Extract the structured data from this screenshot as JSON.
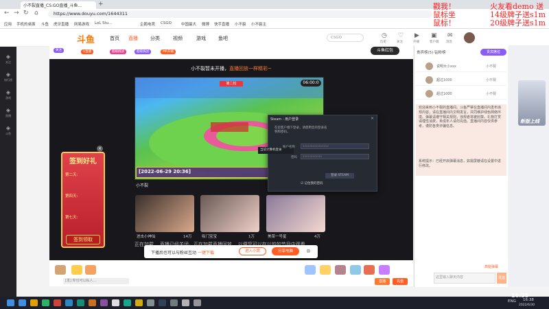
{
  "browser": {
    "tab_title": "小不裂直播_CS:GO直播_斗鱼...",
    "new_tab": "+",
    "url": "https://www.douyu.com/1644311",
    "bookmarks": [
      "应用",
      "手机的桌面",
      "斗鱼",
      "虎牙直播",
      "网易游戏",
      "LoL Stu...",
      "企鹅电竞",
      "CSGO",
      "中国最大",
      "微博",
      "快手直播",
      "小不裂",
      "小不裂主"
    ]
  },
  "site": {
    "logo": "斗鱼",
    "nav": [
      "首页",
      "直播",
      "分类",
      "视频",
      "游戏",
      "鱼吧"
    ],
    "nav_active_index": 1,
    "search_placeholder": "CSGO",
    "header_icons": [
      "历史",
      "关注",
      "开播",
      "客户端",
      "消息"
    ],
    "accent": "#ff5d23"
  },
  "left_rail": [
    "关注",
    "排行榜",
    "游戏",
    "直播",
    "斗鱼"
  ],
  "room": {
    "chips": [
      "关注",
      "V直播",
      "超级挑战",
      "超级挑战",
      "MR开播"
    ],
    "hongbao_label": "斗鱼红包"
  },
  "player": {
    "offline_msg": "小不裂暂未开播，",
    "offline_link": "直播回放一样精彩~",
    "game_time": "06:00:0",
    "game_sign": "第二轮",
    "game_date": "[2022-06-29 20:36]",
    "streamer_name": "小不裂",
    "recommend": [
      {
        "title": "进击小神仙",
        "count": "14万",
        "colors": "#3a2f2a,#d9a98c"
      },
      {
        "title": "吸门宝宝",
        "count": "1万",
        "colors": "#6a5a55,#efd0c8"
      },
      {
        "title": "美菜一号星",
        "count": "4万",
        "colors": "#8a7a9a,#f4d8d0"
      }
    ],
    "mask_text": "正在加载... 直播已经关闭，正在加载直播回放... 以便您可以在以前的节目中观看"
  },
  "login_bar": {
    "text": "下播后也可以与粉丝互动",
    "link": "一键下载",
    "btn_secondary": "进入小窝",
    "btn_primary": "分享电脑"
  },
  "signin_card": {
    "title": "签到好礼",
    "days": [
      "第二天:",
      "第四天:",
      "第七天:"
    ],
    "button": "签到领取",
    "close": "×"
  },
  "steam_dialog": {
    "title": "Steam - 用户登录",
    "close": "×",
    "message": "在您客户端下登录，请使用您的登录名称和密码。",
    "device_label": "当前计算机登录",
    "account_label": "账户名称",
    "password_label": "密码",
    "account_value": "xxxxxxxxxxxxxxxx",
    "password_value": "xxxxxxxxxxxx",
    "login_button": "登录 STEAM",
    "remember": "记住我的密码"
  },
  "bottom_bar": {
    "chat_placeholder": "[发] 你也可以私人...",
    "btn1": "直播",
    "btn2": "充值"
  },
  "right_panel": {
    "head": "贵宾榜(5)·钻粉榜",
    "btn": "贵宾席位",
    "ranks": [
      {
        "name": "说明大小xxx",
        "badge": "小不裂"
      },
      {
        "name": "超过1000",
        "badge": "小不裂"
      },
      {
        "name": "超过1000",
        "badge": "小不裂"
      }
    ],
    "notice": "欢迎来到小不裂的直播间。斗鱼严禁在直播间内发布违规内容，请在直播间内文明发言，共同维护绿色网络环境。弹幕请遵守相关规则，违规者将被封禁。礼物打赏请理性消费，未成年人请勿充值。直播间内容仅供参考，谨防各类诈骗信息。",
    "sysmsg": "系统提示：已经开启弹幕消息，如需屏蔽请在设置中进行修改。",
    "footer_left": "",
    "footer_right": "高能弹幕",
    "input_placeholder": "这里输入聊天内容",
    "send": "发送"
  },
  "right_side": {
    "ad_text": "新版上线"
  },
  "overlay": {
    "left_lines": [
      "戳我！",
      "鼠标坐",
      "鼠标！"
    ],
    "right_lines": [
      "火友看demo 送",
      "14级牌子送s1m",
      "20级牌子送s1m"
    ],
    "left_color": "#ff2020",
    "right_color": "#ff2020"
  },
  "taskbar": {
    "tray": "ENG",
    "clock": "16:38",
    "date": "2022/6/30"
  },
  "watermark": "16:35"
}
